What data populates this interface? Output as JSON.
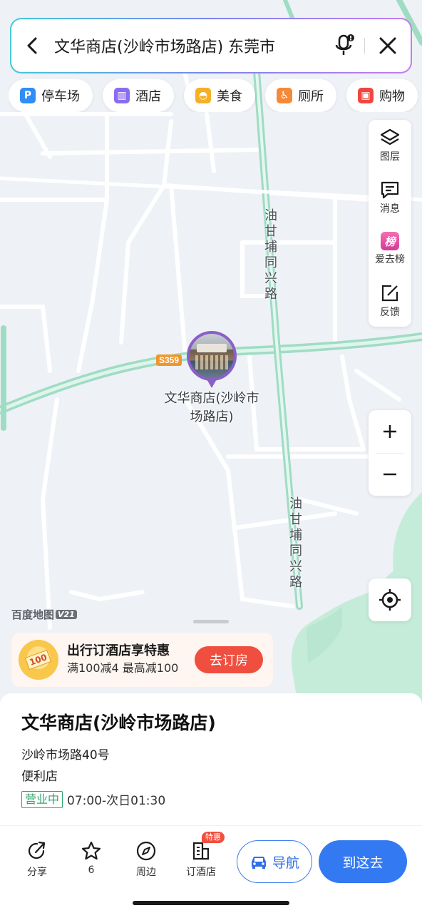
{
  "search": {
    "query": "文华商店(沙岭市场路店) 东莞市"
  },
  "chips": [
    {
      "label": "停车场",
      "icon": "parking-icon",
      "color": "#2f8ef5",
      "glyph": "P"
    },
    {
      "label": "酒店",
      "icon": "hotel-icon",
      "color": "#8b6cf0",
      "glyph": "▥"
    },
    {
      "label": "美食",
      "icon": "food-icon",
      "color": "#f5b026",
      "glyph": "◓"
    },
    {
      "label": "厕所",
      "icon": "toilet-icon",
      "color": "#f38a3a",
      "glyph": "♿"
    },
    {
      "label": "购物",
      "icon": "shopping-icon",
      "color": "#f0463f",
      "glyph": "▣"
    }
  ],
  "tools": {
    "layers": "图层",
    "messages": "消息",
    "ranking": "爱去榜",
    "ranking_glyph": "榜",
    "feedback": "反馈"
  },
  "map": {
    "road_label_1": "油甘埔同兴路",
    "road_label_2": "油甘埔同兴路",
    "highway_shield": "S359",
    "poi_name": "文华商店(沙岭市场路店)",
    "watermark": "百度地图",
    "watermark_version": "V21"
  },
  "promo": {
    "badge": "100",
    "title": "出行订酒店享特惠",
    "subtitle": "满100减4 最高减100",
    "button": "去订房"
  },
  "place": {
    "name": "文华商店(沙岭市场路店)",
    "address": "沙岭市场路40号",
    "category": "便利店",
    "status": "营业中",
    "hours": "07:00-次日01:30"
  },
  "actions": {
    "share": "分享",
    "favorite_count": "6",
    "nearby": "周边",
    "book_hotel": "订酒店",
    "book_hotel_badge": "特惠",
    "navigate": "导航",
    "go_here": "到这去"
  },
  "colors": {
    "accent_blue": "#3379f2",
    "promo_red": "#f04e3e",
    "open_green": "#2fa56b",
    "poi_purple": "#8a5fc7",
    "road_teal": "#a9e4cf"
  }
}
